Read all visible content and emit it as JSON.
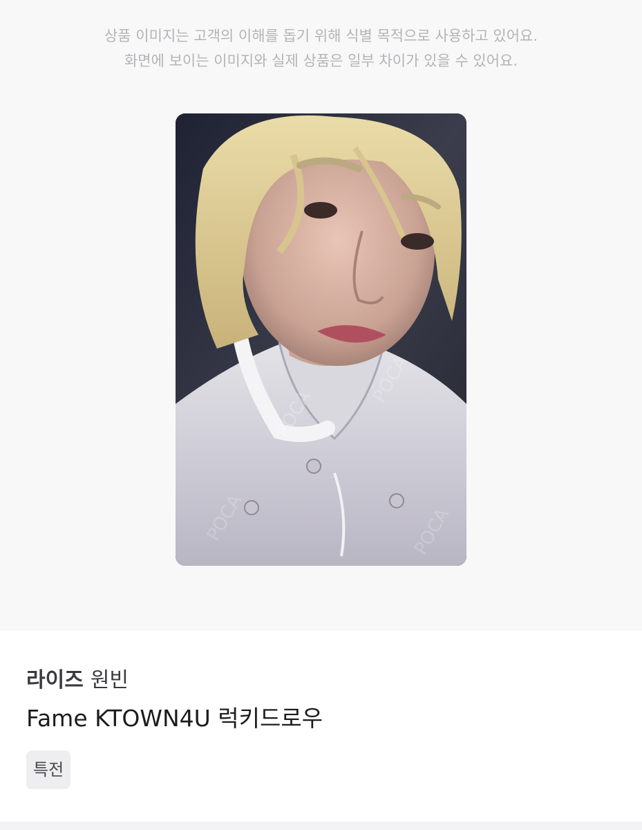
{
  "notice": {
    "line1": "상품 이미지는 고객의 이해를 돕기 위해 식별 목적으로 사용하고 있어요.",
    "line2": "화면에 보이는 이미지와 실제 상품은 일부 차이가 있을 수 있어요."
  },
  "photocard": {
    "watermark": "POCA"
  },
  "product": {
    "artist": "라이즈",
    "member": "원빈",
    "title": "Fame KTOWN4U 럭키드로우",
    "tag": "특전"
  }
}
